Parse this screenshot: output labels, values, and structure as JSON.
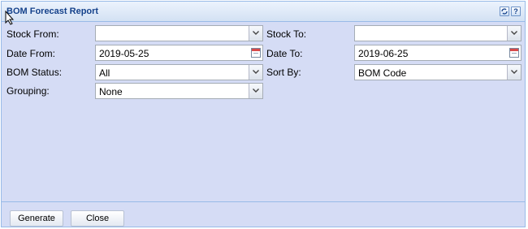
{
  "panel": {
    "title": "BOM Forecast Report",
    "tools": {
      "refresh_icon": "refresh-icon",
      "help_label": "?"
    }
  },
  "form": {
    "stock_from": {
      "label": "Stock From:",
      "value": ""
    },
    "stock_to": {
      "label": "Stock To:",
      "value": ""
    },
    "date_from": {
      "label": "Date From:",
      "value": "2019-05-25"
    },
    "date_to": {
      "label": "Date To:",
      "value": "2019-06-25"
    },
    "bom_status": {
      "label": "BOM Status:",
      "value": "All"
    },
    "sort_by": {
      "label": "Sort By:",
      "value": "BOM Code"
    },
    "grouping": {
      "label": "Grouping:",
      "value": "None"
    }
  },
  "footer": {
    "generate_label": "Generate",
    "close_label": "Close"
  }
}
